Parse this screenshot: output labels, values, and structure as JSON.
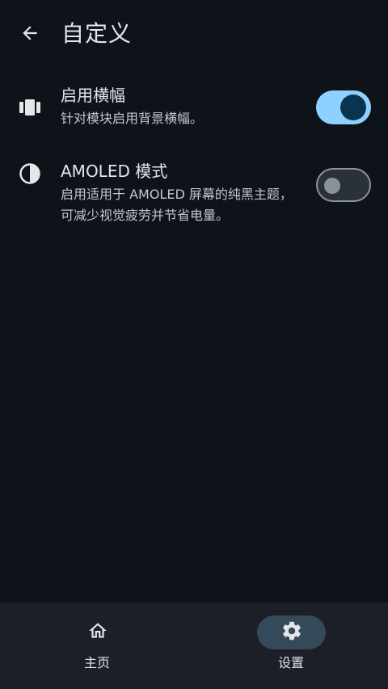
{
  "header": {
    "title": "自定义",
    "back_icon": "arrow-left-icon"
  },
  "settings": [
    {
      "title": "启用横幅",
      "description": "针对模块启用背景横幅。",
      "icon": "view-carousel-icon",
      "enabled": true
    },
    {
      "title": "AMOLED 模式",
      "description": "启用适用于 AMOLED 屏幕的纯黑主题，可减少视觉疲劳并节省电量。",
      "icon": "contrast-icon",
      "enabled": false
    }
  ],
  "bottom_nav": {
    "items": [
      {
        "label": "主页",
        "icon": "home-icon",
        "active": false
      },
      {
        "label": "设置",
        "icon": "gear-icon",
        "active": true
      }
    ]
  },
  "colors": {
    "background": "#0e131a",
    "nav_background": "#1b2027",
    "switch_on_track": "#8ed0ff",
    "switch_on_thumb": "#0a344e",
    "nav_active_indicator": "#344959"
  }
}
